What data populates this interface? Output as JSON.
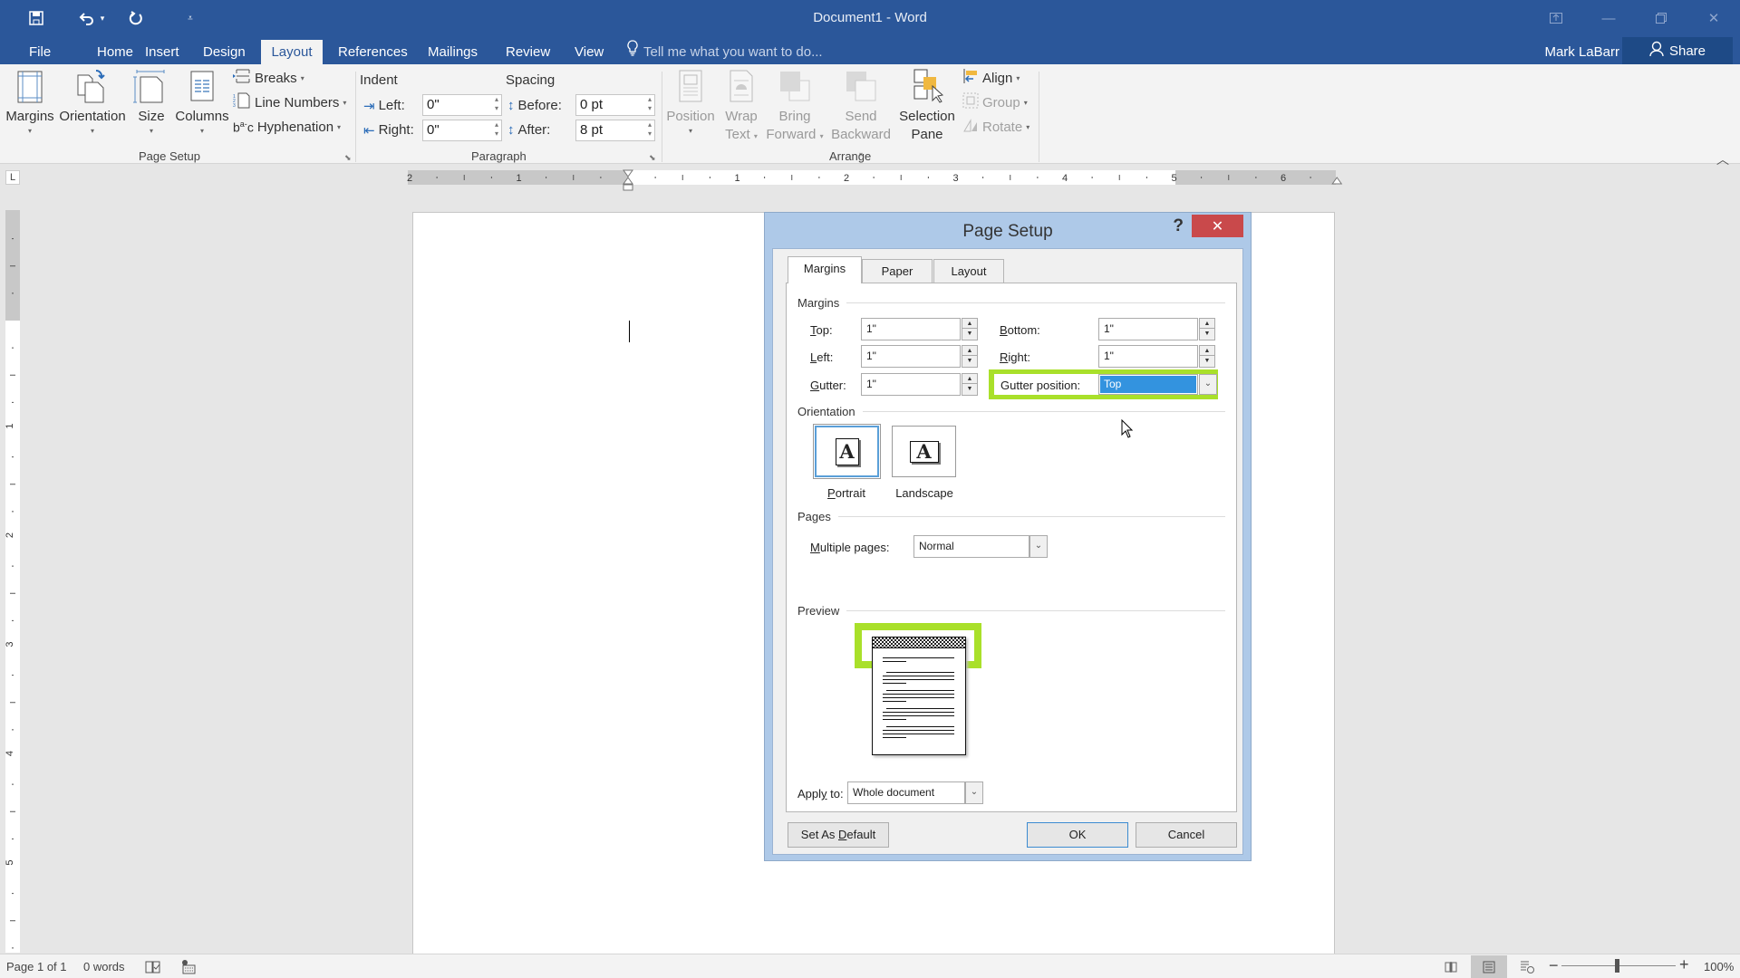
{
  "app": {
    "title": "Document1 - Word",
    "qat": {
      "save_icon": "save-icon",
      "undo_icon": "undo-icon",
      "redo_icon": "repeat-icon",
      "customize_icon": "customize-qat-icon"
    },
    "window_controls": [
      "ribbon-display-options",
      "minimize",
      "restore",
      "close"
    ]
  },
  "tabs": [
    {
      "label": "File"
    },
    {
      "label": "Home"
    },
    {
      "label": "Insert"
    },
    {
      "label": "Design"
    },
    {
      "label": "Layout",
      "active": true
    },
    {
      "label": "References"
    },
    {
      "label": "Mailings"
    },
    {
      "label": "Review"
    },
    {
      "label": "View"
    }
  ],
  "tellme": {
    "placeholder": "Tell me what you want to do..."
  },
  "user": {
    "name": "Mark LaBarr",
    "share_label": "Share"
  },
  "ribbon": {
    "page_setup": {
      "label": "Page Setup",
      "margins": "Margins",
      "orientation": "Orientation",
      "size": "Size",
      "columns": "Columns",
      "breaks": "Breaks",
      "line_numbers": "Line Numbers",
      "hyphenation": "Hyphenation"
    },
    "paragraph": {
      "label": "Paragraph",
      "indent_label": "Indent",
      "spacing_label": "Spacing",
      "left_label": "Left:",
      "left_value": "0\"",
      "right_label": "Right:",
      "right_value": "0\"",
      "before_label": "Before:",
      "before_value": "0 pt",
      "after_label": "After:",
      "after_value": "8 pt"
    },
    "arrange": {
      "label": "Arrange",
      "position": "Position",
      "wrap_text_1": "Wrap",
      "wrap_text_2": "Text",
      "bring_forward_1": "Bring",
      "bring_forward_2": "Forward",
      "send_backward_1": "Send",
      "send_backward_2": "Backward",
      "selection_pane_1": "Selection",
      "selection_pane_2": "Pane",
      "align": "Align",
      "group": "Group",
      "rotate": "Rotate"
    }
  },
  "ruler": {
    "horizontal_labels": [
      "2",
      "1",
      "1",
      "2",
      "3",
      "4",
      "5",
      "6"
    ],
    "vertical_labels": [
      "1",
      "1",
      "2",
      "3",
      "4",
      "5"
    ],
    "tab_selector": "L"
  },
  "dialog": {
    "title": "Page Setup",
    "help": "?",
    "tabs": [
      {
        "label": "Margins",
        "active": true
      },
      {
        "label": "Paper"
      },
      {
        "label": "Layout"
      }
    ],
    "margins_section": "Margins",
    "top_label": "Top:",
    "top_value": "1\"",
    "bottom_label": "Bottom:",
    "bottom_value": "1\"",
    "left_label": "Left:",
    "left_value": "1\"",
    "right_label": "Right:",
    "right_value": "1\"",
    "gutter_label": "Gutter:",
    "gutter_value": "1\"",
    "gutter_position_label": "Gutter position:",
    "gutter_position_value": "Top",
    "orientation_section": "Orientation",
    "portrait_label": "Portrait",
    "landscape_label": "Landscape",
    "orientation_selected": "Portrait",
    "orientation_glyph": "A",
    "pages_section": "Pages",
    "multiple_pages_label": "Multiple pages:",
    "multiple_pages_value": "Normal",
    "preview_section": "Preview",
    "apply_to_label": "Apply to:",
    "apply_to_value": "Whole document",
    "set_default_label": "Set As Default",
    "ok_label": "OK",
    "cancel_label": "Cancel",
    "highlight_color": "#a9e02a"
  },
  "status": {
    "page": "Page 1 of 1",
    "words": "0 words",
    "zoom": "100%",
    "zoom_minus": "−",
    "zoom_plus": "+"
  }
}
